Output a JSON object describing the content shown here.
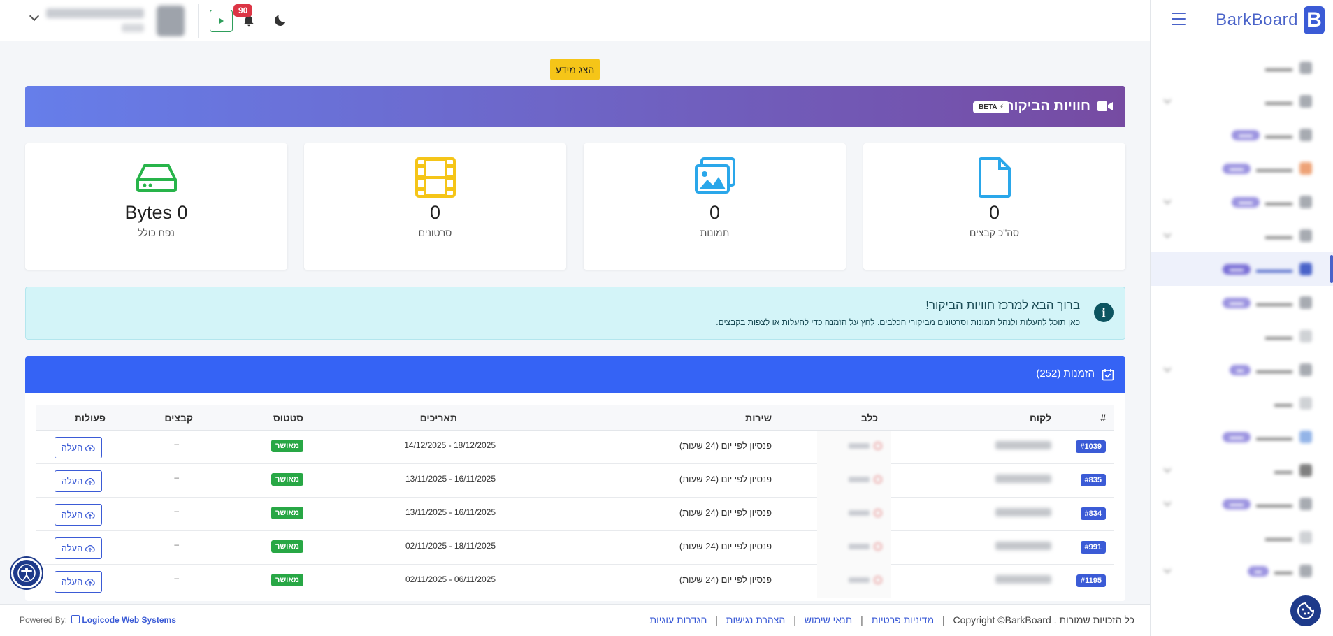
{
  "brand": {
    "name": "BarkBoard",
    "logo_letter": "B"
  },
  "topbar": {
    "notifications_count": "90"
  },
  "content": {
    "show_info_label": "הצג מידע",
    "banner": {
      "title": "חוויות הביקור",
      "beta": "BETA ⚡"
    },
    "stats": [
      {
        "value": "0",
        "label": "סה\"כ קבצים",
        "icon": "file-icon",
        "color": "#2aa7ea"
      },
      {
        "value": "0",
        "label": "תמונות",
        "icon": "images-icon",
        "color": "#2aa7ea"
      },
      {
        "value": "0",
        "label": "סרטונים",
        "icon": "film-icon",
        "color": "#f5c518"
      },
      {
        "value": "Bytes 0",
        "label": "נפח כולל",
        "icon": "hard-drive-icon",
        "color": "#28b44a"
      }
    ],
    "welcome": {
      "title": "ברוך הבא למרכז חוויות הביקור!",
      "text": "כאן תוכל להעלות ולנהל תמונות וסרטונים מביקורי הכלבים. לחץ על הזמנה כדי להעלות או לצפות בקבצים."
    },
    "orders": {
      "title": "הזמנות (252)",
      "columns": {
        "id": "#",
        "customer": "לקוח",
        "dog": "כלב",
        "service": "שירות",
        "dates": "תאריכים",
        "status": "סטטוס",
        "files": "קבצים",
        "actions": "פעולות"
      },
      "rows": [
        {
          "id": "#1039",
          "service": "פנסיון לפי יום (24 שעות)",
          "dates": "14/12/2025 - 18/12/2025",
          "status": "מאושר",
          "files": "–",
          "action": "העלה"
        },
        {
          "id": "#835",
          "service": "פנסיון לפי יום (24 שעות)",
          "dates": "13/11/2025 - 16/11/2025",
          "status": "מאושר",
          "files": "–",
          "action": "העלה"
        },
        {
          "id": "#834",
          "service": "פנסיון לפי יום (24 שעות)",
          "dates": "13/11/2025 - 16/11/2025",
          "status": "מאושר",
          "files": "–",
          "action": "העלה"
        },
        {
          "id": "#991",
          "service": "פנסיון לפי יום (24 שעות)",
          "dates": "02/11/2025 - 18/11/2025",
          "status": "מאושר",
          "files": "–",
          "action": "העלה"
        },
        {
          "id": "#1195",
          "service": "פנסיון לפי יום (24 שעות)",
          "dates": "02/11/2025 - 06/11/2025",
          "status": "מאושר",
          "files": "–",
          "action": "העלה"
        }
      ]
    }
  },
  "footer": {
    "powered_by": "Powered By:",
    "powered_brand": "Logicode Web Systems",
    "copyright": "Copyright ©BarkBoard . כל הזכויות שמורות",
    "links": [
      "מדיניות פרטיות",
      "תנאי שימוש",
      "הצהרת נגישות",
      "הגדרות עוגיות"
    ]
  },
  "colors": {
    "primary": "#3563f5",
    "success": "#28a745",
    "warning": "#f5c518",
    "danger": "#dc3545"
  }
}
